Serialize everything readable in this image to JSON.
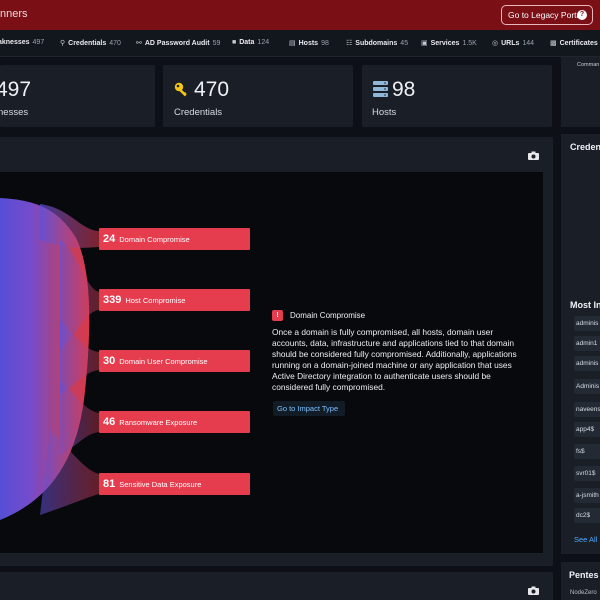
{
  "header": {
    "title_fragment": "nners",
    "legacy_button": "Go to Legacy Portal",
    "help_glyph": "?"
  },
  "categories": [
    {
      "label": "aknesses",
      "count": "497",
      "icon": ""
    },
    {
      "label": "Credentials",
      "count": "470",
      "icon": "key-icon"
    },
    {
      "label": "AD Password Audit",
      "count": "59",
      "icon": "lock-icon"
    },
    {
      "label": "Data",
      "count": "124",
      "icon": "database-icon"
    },
    {
      "label": "Hosts",
      "count": "98",
      "icon": "server-icon"
    },
    {
      "label": "Subdomains",
      "count": "45",
      "icon": "sitemap-icon"
    },
    {
      "label": "Services",
      "count": "1.5K",
      "icon": "service-icon"
    },
    {
      "label": "URLs",
      "count": "144",
      "icon": "globe-icon"
    },
    {
      "label": "Certificates",
      "count": "",
      "icon": "certificate-icon"
    }
  ],
  "stats": {
    "weaknesses": {
      "value": "497",
      "label": "nesses"
    },
    "credentials": {
      "value": "470",
      "label": "Credentials",
      "icon": "key-icon",
      "color": "#f5c518"
    },
    "hosts": {
      "value": "98",
      "label": "Hosts",
      "icon": "server-icon",
      "color": "#8fb8d8"
    }
  },
  "right_top": {
    "label": "Comman"
  },
  "impacts": [
    {
      "count": "24",
      "label": "Domain Compromise"
    },
    {
      "count": "339",
      "label": "Host Compromise"
    },
    {
      "count": "30",
      "label": "Domain User Compromise"
    },
    {
      "count": "46",
      "label": "Ransomware Exposure"
    },
    {
      "count": "81",
      "label": "Sensitive Data Exposure"
    }
  ],
  "impact_detail": {
    "title": "Domain Compromise",
    "description": "Once a domain is fully compromised, all hosts, domain user accounts, data, infrastructure and applications tied to that domain should be considered fully compromised. Additionally, applications running on a domain-joined machine or any application that uses Active Directory integration to authenticate users should be considered fully compromised.",
    "link": "Go to Impact Type"
  },
  "right_panel": {
    "credentials_title": "Creden",
    "most_title": "Most In",
    "items": [
      "adminis",
      "admin1",
      "adminis",
      "Adminis",
      "naveens",
      "app4$",
      "fs$",
      "svr01$",
      "a-jsmith",
      "dc2$"
    ],
    "see_all": "See All"
  },
  "bottom_right": {
    "title": "Pentes",
    "sub": "NodeZero"
  },
  "colors": {
    "accent": "#e53c4e",
    "header": "#7a0f16",
    "link": "#4ea8ff",
    "flow_start": "#5a52e0",
    "flow_end": "#e53c4e"
  }
}
